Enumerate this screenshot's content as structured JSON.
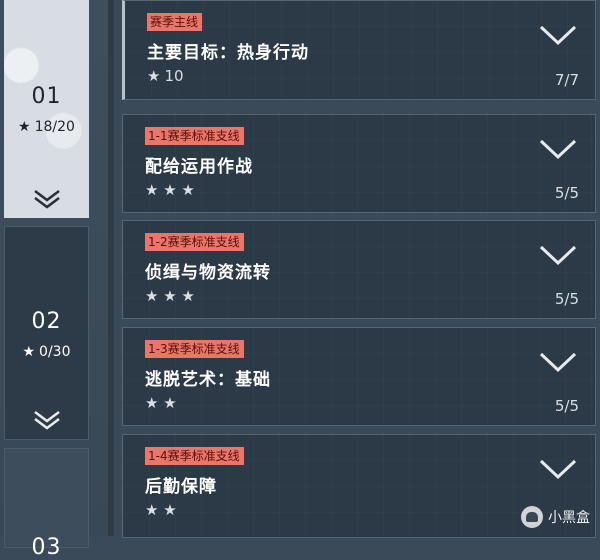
{
  "chapters": [
    {
      "num": "01",
      "star_icon": "★",
      "progress": "18/20",
      "state": "selected"
    },
    {
      "num": "02",
      "star_icon": "★",
      "progress": "0/30",
      "state": "normal"
    },
    {
      "num": "03",
      "state": "normal"
    }
  ],
  "quests": [
    {
      "tag": "赛季主线",
      "title": "主要目标：热身行动",
      "stars": "★",
      "star_count": "10",
      "progress": "7/7"
    },
    {
      "tag": "1-1赛季标准支线",
      "title": "配给运用作战",
      "stars": "★ ★ ★",
      "progress": "5/5"
    },
    {
      "tag": "1-2赛季标准支线",
      "title": "侦缉与物资流转",
      "stars": "★ ★ ★",
      "progress": "5/5"
    },
    {
      "tag": "1-3赛季标准支线",
      "title": "逃脱艺术：基础",
      "stars": "★ ★",
      "progress": "5/5"
    },
    {
      "tag": "1-4赛季标准支线",
      "title": "后勤保障",
      "stars": "★ ★"
    }
  ],
  "watermark": {
    "text": "小黑盒"
  },
  "colors": {
    "tag_bg": "#e8766b",
    "panel_bg": "#2c3947",
    "selected_chapter_bg": "#d7dde2"
  }
}
